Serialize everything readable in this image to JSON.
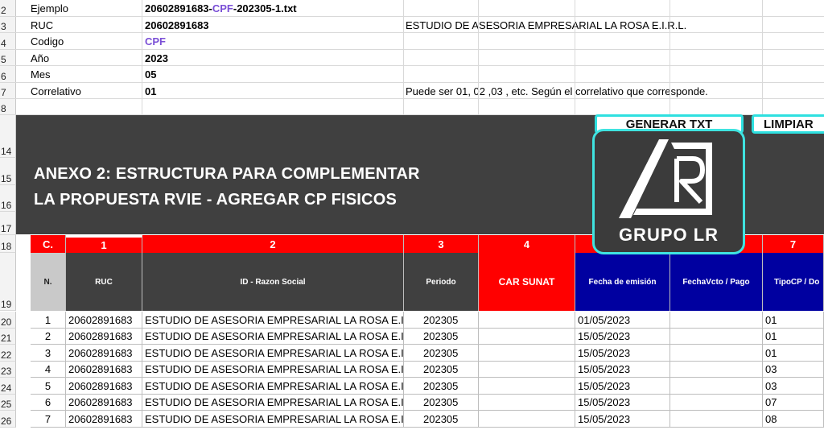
{
  "top_rows": [
    {
      "rownum": "2",
      "label": "Ejemplo",
      "value_parts": [
        "20602891683-",
        "CPF",
        "-202305-1.txt"
      ],
      "extra": ""
    },
    {
      "rownum": "3",
      "label": "RUC",
      "value": "20602891683",
      "extra": "ESTUDIO DE ASESORIA EMPRESARIAL LA ROSA E.I.R.L."
    },
    {
      "rownum": "4",
      "label": "Codigo",
      "value": "CPF",
      "extra": ""
    },
    {
      "rownum": "5",
      "label": "Año",
      "value": "2023",
      "extra": ""
    },
    {
      "rownum": "6",
      "label": "Mes",
      "value": "05",
      "extra": ""
    },
    {
      "rownum": "7",
      "label": "Correlativo",
      "value": "01",
      "extra": "Puede ser 01, 02 ,03 , etc. Según el correlativo que corresponde."
    },
    {
      "rownum": "8"
    }
  ],
  "band_rownums": [
    "14",
    "15",
    "16",
    "17"
  ],
  "title_line1": "ANEXO 2: ESTRUCTURA PARA COMPLEMENTAR",
  "title_line2": "LA PROPUESTA RVIE - AGREGAR CP FISICOS",
  "buttons": {
    "generate": "GENERAR TXT",
    "clear": "LIMPIAR"
  },
  "logo_text": "GRUPO LR",
  "header_rownums": [
    "18",
    "19"
  ],
  "col_numbers": [
    "C.",
    "1",
    "2",
    "3",
    "4",
    "",
    "7"
  ],
  "col_headers": [
    "N.",
    "RUC",
    "ID - Razon Social",
    "Periodo",
    "CAR SUNAT",
    "Fecha de emisión",
    "FechaVcto / Pago",
    "TipoCP / Do"
  ],
  "rows": [
    {
      "rownum": "20",
      "n": "1",
      "ruc": "20602891683",
      "razon": "ESTUDIO DE ASESORIA EMPRESARIAL LA ROSA E.I.R.L.",
      "periodo": "202305",
      "fecha": "01/05/2023",
      "tipo": "01"
    },
    {
      "rownum": "21",
      "n": "2",
      "ruc": "20602891683",
      "razon": "ESTUDIO DE ASESORIA EMPRESARIAL LA ROSA E.I.R.L.",
      "periodo": "202305",
      "fecha": "15/05/2023",
      "tipo": "01"
    },
    {
      "rownum": "22",
      "n": "3",
      "ruc": "20602891683",
      "razon": "ESTUDIO DE ASESORIA EMPRESARIAL LA ROSA E.I.R.L.",
      "periodo": "202305",
      "fecha": "15/05/2023",
      "tipo": "01"
    },
    {
      "rownum": "23",
      "n": "4",
      "ruc": "20602891683",
      "razon": "ESTUDIO DE ASESORIA EMPRESARIAL LA ROSA E.I.R.L.",
      "periodo": "202305",
      "fecha": "15/05/2023",
      "tipo": "03"
    },
    {
      "rownum": "24",
      "n": "5",
      "ruc": "20602891683",
      "razon": "ESTUDIO DE ASESORIA EMPRESARIAL LA ROSA E.I.R.L.",
      "periodo": "202305",
      "fecha": "15/05/2023",
      "tipo": "03"
    },
    {
      "rownum": "25",
      "n": "6",
      "ruc": "20602891683",
      "razon": "ESTUDIO DE ASESORIA EMPRESARIAL LA ROSA E.I.R.L.",
      "periodo": "202305",
      "fecha": "15/05/2023",
      "tipo": "07"
    },
    {
      "rownum": "26",
      "n": "7",
      "ruc": "20602891683",
      "razon": "ESTUDIO DE ASESORIA EMPRESARIAL LA ROSA E.I.R.L.",
      "periodo": "202305",
      "fecha": "15/05/2023",
      "tipo": "08"
    }
  ],
  "colors": {
    "red": "#ff0000",
    "navy": "#0000a0",
    "dark": "#404040",
    "gray_hdr": "#c9c9c9",
    "cyan": "#2ee0e0",
    "purple": "#7a4fd6"
  }
}
